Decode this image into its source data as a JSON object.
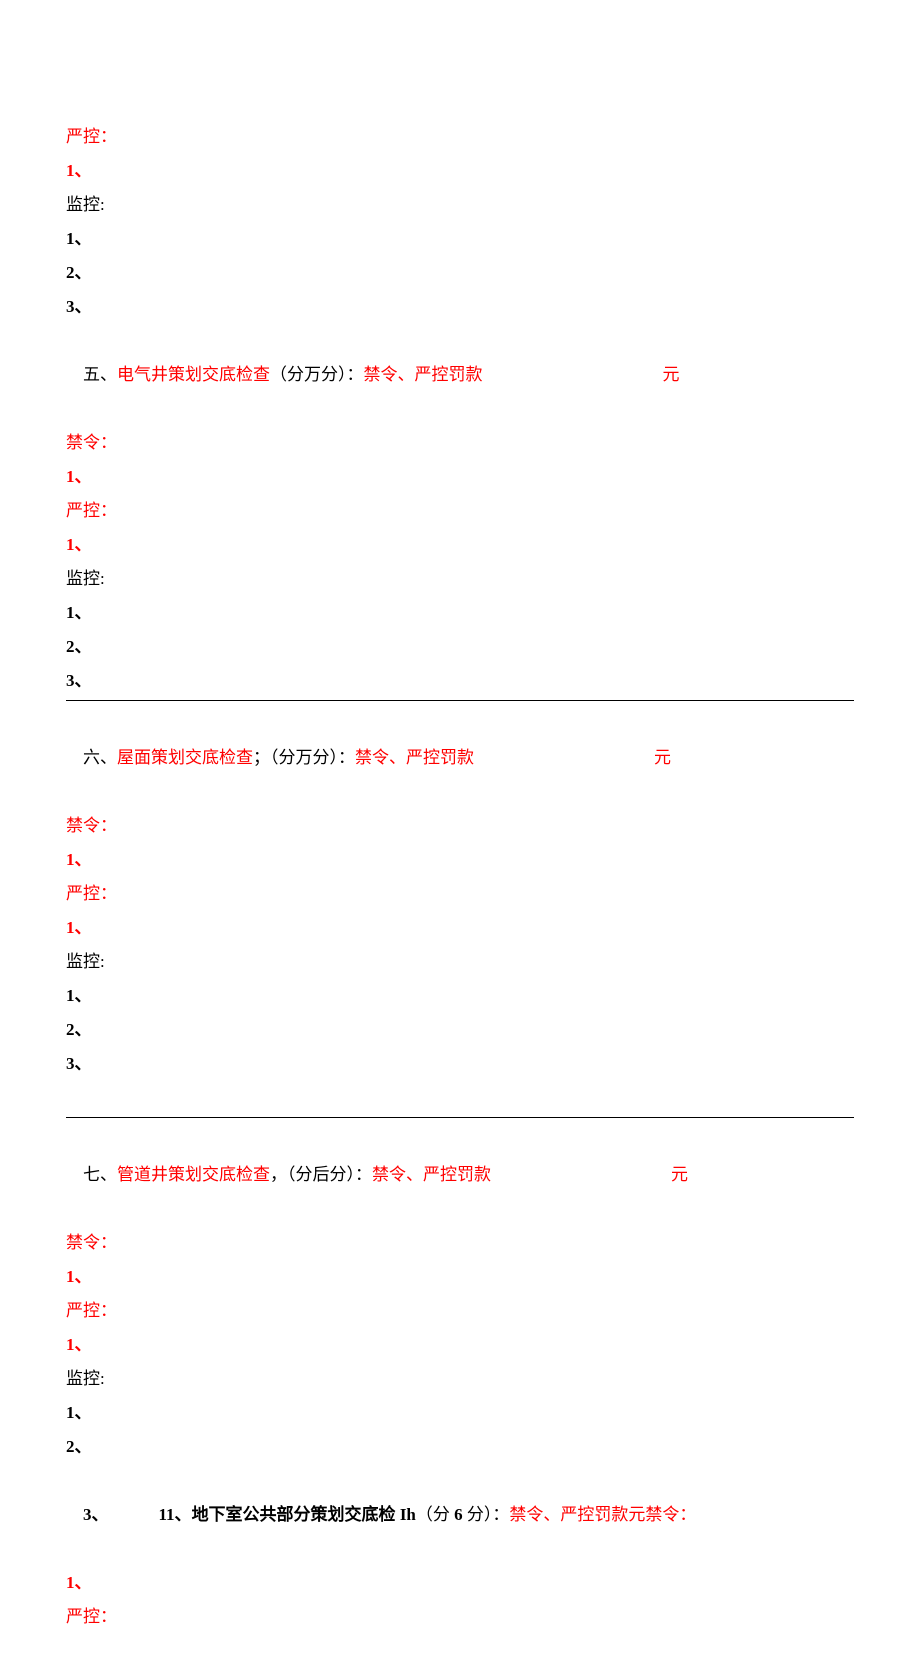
{
  "labels": {
    "yankong": "严控：",
    "jinling": "禁令：",
    "jiankong": "监控:",
    "n1": "1、",
    "n2": "2、",
    "n3": "3、",
    "yuan": "元"
  },
  "sec5": {
    "prefix": "五、",
    "title": "电气井策划交底检查",
    "score": "（分万分）：",
    "penalty": "禁令、严控罚款"
  },
  "sec6": {
    "prefix": "六、",
    "title": "屋面策划交底检查",
    "sep": "；",
    "score": "（分万分）：",
    "penalty": "禁令、严控罚款"
  },
  "sec7": {
    "prefix": "七、",
    "title": "管道井策划交底检查",
    "sep": "，",
    "score": "（分后分）：",
    "penalty": "禁令、严控罚款"
  },
  "sec11_line": {
    "n3": "3、",
    "n11": "11、",
    "title_a": "地下室公共部分策划交底检 ",
    "ih": "Ih",
    "score_a": "（分 ",
    "six": "6 ",
    "score_b": "分）：",
    "penalty": "禁令、严控罚款元禁令："
  }
}
